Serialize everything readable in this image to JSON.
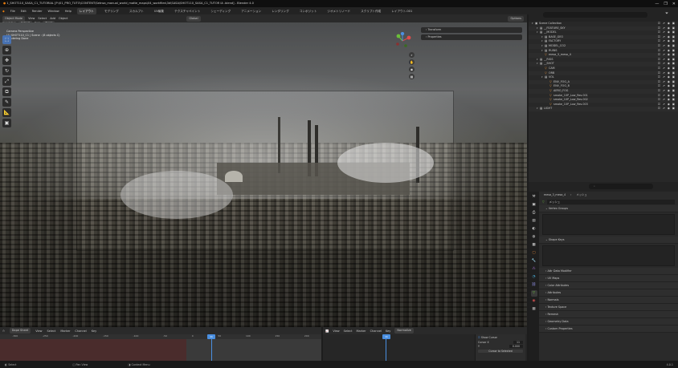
{
  "window": {
    "title": "1_SHOT110_SASA_C1_TUTORIAL [P:\\01_PRO_TUTO\\CONTENT\\Setnsa_manual_world_matte_maps\\04_workfiles\\3d\\SASA\\SHOT110_SASA_C1_TUTOR IA .blend] - Blender 4.0",
    "controls": [
      "—",
      "❐",
      "✕"
    ]
  },
  "menubar": {
    "items": [
      "File",
      "Edit",
      "Render",
      "Window",
      "Help"
    ],
    "workspaces": [
      "レイアウト",
      "モデリング",
      "スカルプト",
      "UV編集",
      "テクスチャペイント",
      "シェーディング",
      "アニメーション",
      "レンダリング",
      "コンポジット",
      "ジオメトリノード",
      "スクリプト作成",
      "レイアウト.001"
    ],
    "active_workspace": 0,
    "scene_label": "Scene",
    "view_layer_label": "ViewLayer"
  },
  "viewport_header": {
    "mode": "Object Mode",
    "menus": [
      "View",
      "Select",
      "Add",
      "Object"
    ],
    "orientation_label": "Orientation",
    "orientation_value": "Default",
    "drag_label": "Drag",
    "drag_value": "Tweak",
    "global": "Global",
    "options": "Options"
  },
  "viewport_info": {
    "line1": "Camera Perspective",
    "line2": "(1) SHOT110_C1 | Scene : (8 objects C)",
    "line3": "Rendering Done"
  },
  "toolbar": {
    "tools": [
      "select-box",
      "cursor",
      "move",
      "rotate",
      "scale",
      "transform",
      "annotate",
      "measure",
      "add-cube"
    ]
  },
  "npanel": {
    "items": [
      "Transform",
      "Properties"
    ]
  },
  "timeline": {
    "editor": "Dope Sheet",
    "menus": [
      "View",
      "Select",
      "Marker",
      "Channel",
      "Key"
    ],
    "summary_label": "Summary",
    "ruler": [
      "-300",
      "-250",
      "-200",
      "-150",
      "-100",
      "-50",
      "0",
      "50",
      "100",
      "150",
      "200"
    ],
    "current_frame": "11"
  },
  "graph": {
    "menus": [
      "View",
      "Select",
      "Marker",
      "Channel",
      "Key"
    ],
    "mode": "Normalize",
    "current_frame": "11",
    "cursor_panel": {
      "title": "Show Cursor",
      "frame_label": "Cursor X",
      "frame_value": "11",
      "y_label": "Y",
      "y_value": "0.000",
      "button": "Cursor to Selected"
    }
  },
  "statusbar": {
    "items": [
      "Select",
      "Pan View",
      "Context Menu"
    ],
    "version": "4.0.1"
  },
  "outliner": {
    "search_placeholder": "",
    "rows": [
      {
        "indent": 0,
        "icon": "scene",
        "label": "Scene Collection",
        "sel": false
      },
      {
        "indent": 1,
        "icon": "collection",
        "label": "__FEATURE_SKY",
        "sel": false
      },
      {
        "indent": 1,
        "icon": "collection",
        "label": "__MODEL",
        "sel": false
      },
      {
        "indent": 2,
        "icon": "collection",
        "label": "BASE_GEO",
        "sel": false
      },
      {
        "indent": 2,
        "icon": "collection",
        "label": "FACTORY",
        "sel": false
      },
      {
        "indent": 2,
        "icon": "collection",
        "label": "MODEL_CO2",
        "sel": false
      },
      {
        "indent": 2,
        "icon": "collection",
        "label": "RUINS",
        "sel": false
      },
      {
        "indent": 2,
        "icon": "object",
        "label": "mesa_3_mesa_4",
        "sel": false
      },
      {
        "indent": 1,
        "icon": "collection",
        "label": "__RIGS",
        "sel": false
      },
      {
        "indent": 1,
        "icon": "collection",
        "label": "__SHOT",
        "sel": false
      },
      {
        "indent": 2,
        "icon": "object",
        "label": "CAM",
        "sel": false
      },
      {
        "indent": 2,
        "icon": "object",
        "label": "ORB",
        "sel": false
      },
      {
        "indent": 2,
        "icon": "collection",
        "label": "VOL",
        "sel": false
      },
      {
        "indent": 3,
        "icon": "object",
        "label": "ENV_FOG_A",
        "sel": false
      },
      {
        "indent": 3,
        "icon": "object",
        "label": "ENV_FOG_B",
        "sel": false
      },
      {
        "indent": 3,
        "icon": "object",
        "label": "AERO_FOG",
        "sel": false
      },
      {
        "indent": 3,
        "icon": "object",
        "label": "smoke_10P_Low_Res.001",
        "sel": false
      },
      {
        "indent": 3,
        "icon": "object",
        "label": "smoke_10P_Low_Res.002",
        "sel": false
      },
      {
        "indent": 3,
        "icon": "object",
        "label": "smoke_10P_Low_Res.003",
        "sel": false
      },
      {
        "indent": 1,
        "icon": "collection",
        "label": "LIGHT",
        "sel": false
      }
    ]
  },
  "properties": {
    "breadcrumb_object": "mesa_3_mesa_4",
    "breadcrumb_data": "メッシュ",
    "data_name": "メッシュ",
    "panels": [
      "Vertex Groups",
      "Shape Keys",
      "Attr Data Modifier",
      "UV Maps",
      "Color Attributes",
      "Attributes",
      "Normals",
      "Texture Space",
      "Remesh",
      "Geometry Data",
      "Custom Properties"
    ],
    "tabs": [
      "tool",
      "render",
      "output",
      "view-layer",
      "scene",
      "world",
      "collection",
      "object",
      "modifiers",
      "particles",
      "physics",
      "constraints",
      "data",
      "material",
      "texture"
    ]
  },
  "colors": {
    "accent": "#4772b3",
    "frame": "#4a8fe0"
  }
}
